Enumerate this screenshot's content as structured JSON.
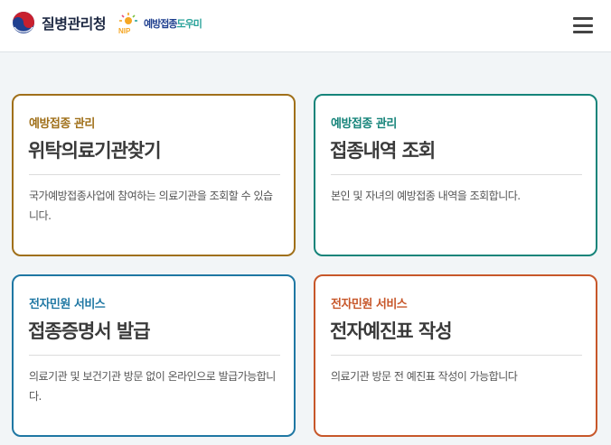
{
  "header": {
    "org_name": "질병관리청",
    "nip_name_a": "예방접종",
    "nip_name_b": "도우미",
    "nip_mark_text": "NIP",
    "menu_icon": "hamburger-icon"
  },
  "cards": [
    {
      "category": "예방접종 관리",
      "title": "위탁의료기관찾기",
      "description": "국가예방접종사업에 참여하는 의료기관을 조회할 수 있습니다.",
      "color": "#a0701a"
    },
    {
      "category": "예방접종 관리",
      "title": "접종내역 조회",
      "description": "본인 및 자녀의 예방접종 내역을 조회합니다.",
      "color": "#16847a"
    },
    {
      "category": "전자민원 서비스",
      "title": "접종증명서 발급",
      "description": "의료기관 및 보건기관 방문 없이 온라인으로 발급가능합니다.",
      "color": "#1f77a3"
    },
    {
      "category": "전자민원 서비스",
      "title": "전자예진표 작성",
      "description": "의료기관 방문 전 예진표 작성이 가능합니다",
      "color": "#c7572a"
    }
  ]
}
